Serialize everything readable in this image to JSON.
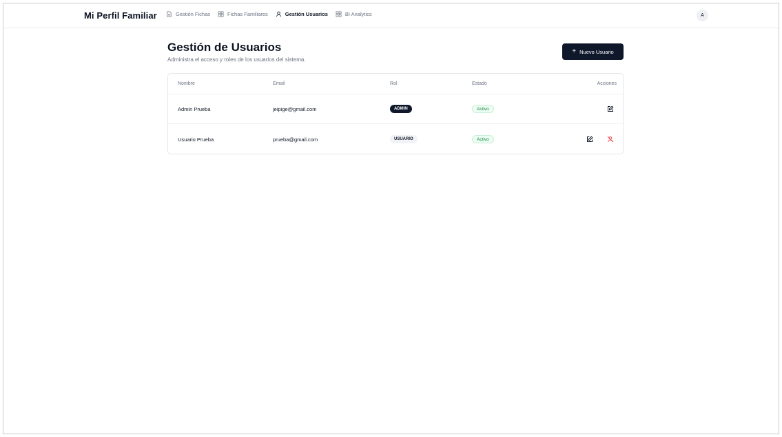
{
  "brand": "Mi Perfil Familiar",
  "nav": [
    {
      "label": "Gestión Fichas",
      "icon": "document-icon",
      "active": false
    },
    {
      "label": "Fichas Familiares",
      "icon": "grid-icon",
      "active": false
    },
    {
      "label": "Gestión Usuarios",
      "icon": "user-icon",
      "active": true
    },
    {
      "label": "BI Analytics",
      "icon": "grid-icon",
      "active": false
    }
  ],
  "avatar_initial": "A",
  "page": {
    "title": "Gestión de Usuarios",
    "subtitle": "Administra el acceso y roles de los usuarios del sistema.",
    "new_button": "Nuevo Usuario",
    "new_button_icon": "+"
  },
  "table": {
    "headers": {
      "name": "Nombre",
      "email": "Email",
      "role": "Rol",
      "status": "Estado",
      "actions": "Acciones"
    },
    "rows": [
      {
        "name": "Admin Prueba",
        "email": "jeipige@gmail.com",
        "role": "ADMIN",
        "status": "Activo"
      },
      {
        "name": "Usuario Prueba",
        "email": "prueba@gmail.com",
        "role": "USUARIO",
        "status": "Activo"
      }
    ]
  },
  "colors": {
    "primary": "#0f172a",
    "muted_text": "#6b7280",
    "status_green": "#15803d",
    "status_bg": "#ecfdf3",
    "danger": "#ef4444"
  }
}
